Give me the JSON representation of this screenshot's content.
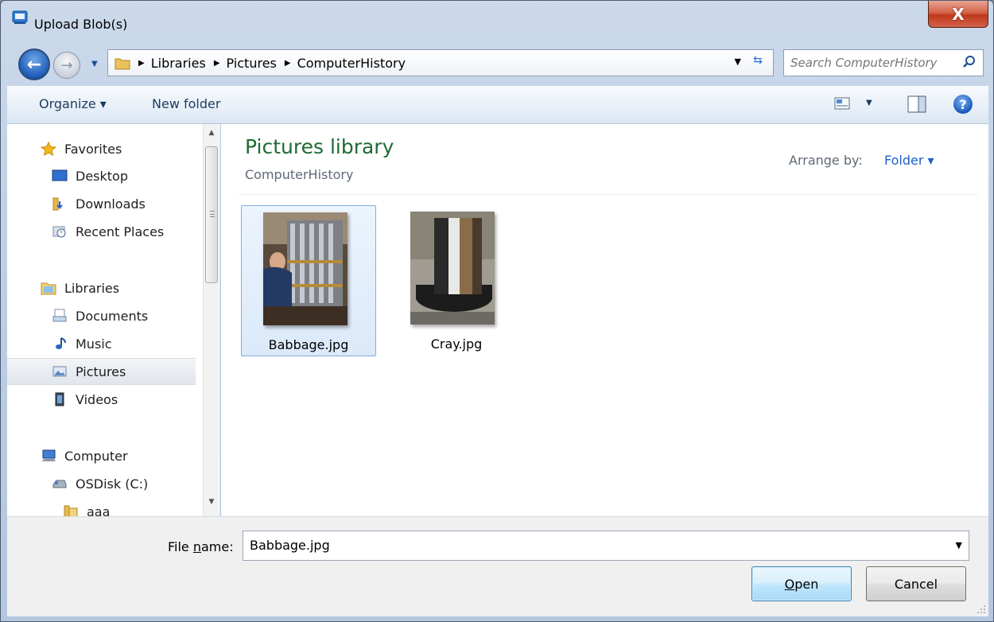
{
  "window": {
    "title": "Upload Blob(s)",
    "close_label": "X"
  },
  "navigation": {
    "back_icon": "back-arrow-icon",
    "forward_icon": "forward-arrow-icon",
    "breadcrumbs": [
      "Libraries",
      "Pictures",
      "ComputerHistory"
    ],
    "search_placeholder": "Search ComputerHistory"
  },
  "toolbar": {
    "organize_label": "Organize ▾",
    "new_folder_label": "New folder",
    "help_label": "?"
  },
  "sidebar": {
    "favorites": [
      {
        "label": "Favorites",
        "icon": "star-icon"
      },
      {
        "label": "Desktop",
        "icon": "desktop-icon"
      },
      {
        "label": "Downloads",
        "icon": "downloads-folder-icon"
      },
      {
        "label": "Recent Places",
        "icon": "recent-places-icon"
      }
    ],
    "libraries": [
      {
        "label": "Libraries",
        "icon": "libraries-icon"
      },
      {
        "label": "Documents",
        "icon": "documents-icon"
      },
      {
        "label": "Music",
        "icon": "music-icon"
      },
      {
        "label": "Pictures",
        "icon": "pictures-icon",
        "selected": true
      },
      {
        "label": "Videos",
        "icon": "videos-icon"
      }
    ],
    "computer": [
      {
        "label": "Computer",
        "icon": "computer-icon"
      },
      {
        "label": "OSDisk (C:)",
        "icon": "drive-icon"
      },
      {
        "label": "aaa",
        "icon": "folder-icon"
      }
    ]
  },
  "content": {
    "library_title": "Pictures library",
    "library_subtitle": "ComputerHistory",
    "arrange_by_label": "Arrange by:",
    "arrange_by_value": "Folder ▾",
    "files": [
      {
        "name": "Babbage.jpg",
        "selected": true
      },
      {
        "name": "Cray.jpg",
        "selected": false
      }
    ]
  },
  "bottom": {
    "file_name_label_prefix": "File ",
    "file_name_label_underlined": "n",
    "file_name_label_suffix": "ame:",
    "file_name_value": "Babbage.jpg",
    "open_label_underlined": "O",
    "open_label_rest": "pen",
    "cancel_label": "Cancel"
  },
  "colors": {
    "library_title": "#1e6b34",
    "link_blue": "#1d5fc8",
    "close_red": "#c0391b"
  }
}
